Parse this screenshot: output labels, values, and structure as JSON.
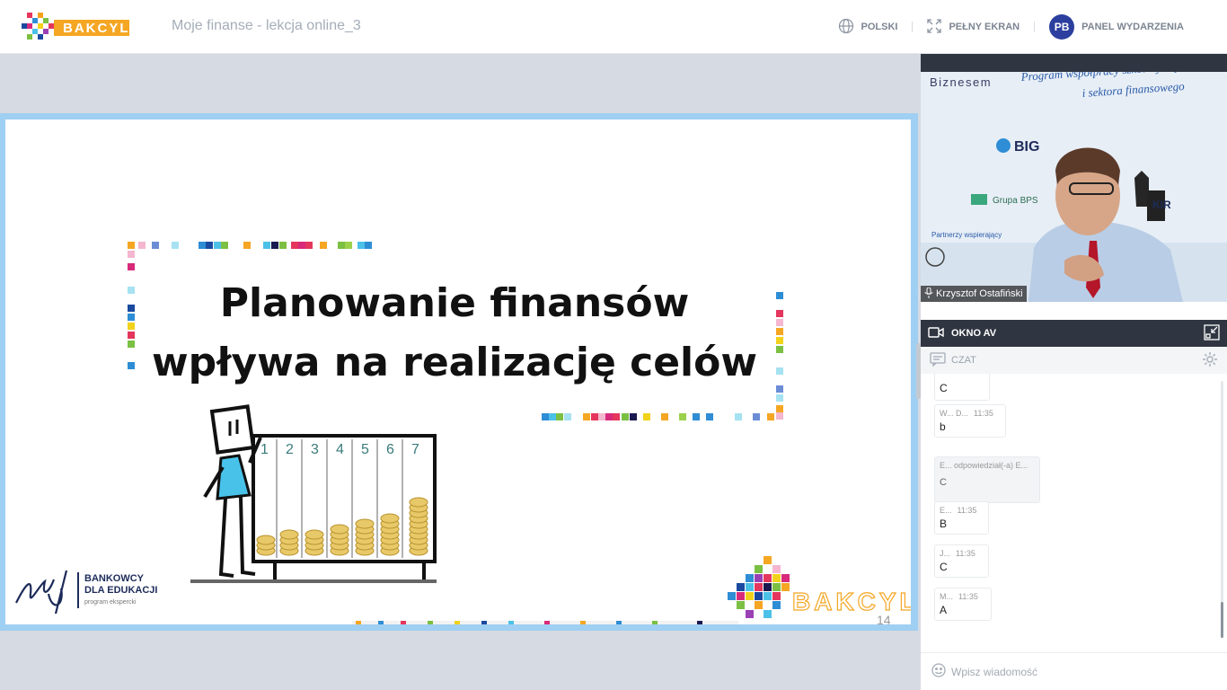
{
  "header": {
    "logo_text": "BAKCYL",
    "event_title": "Moje finanse - lekcja online_3",
    "language_label": "POLSKI",
    "fullscreen_label": "PEŁNY EKRAN",
    "avatar_initials": "PB",
    "panel_label": "PANEL WYDARZENIA"
  },
  "slide": {
    "title_line1": "Planowanie finansów",
    "title_line2": "wpływa na realizację celów",
    "page_number": "14",
    "sponsor_line1": "BANKOWCY",
    "sponsor_line2": "DLA EDUKACJI",
    "sponsor_line3": "program ekspercki",
    "footer_logo_text": "BAKCYL",
    "chart_labels": [
      "1",
      "2",
      "3",
      "4",
      "5",
      "6",
      "7"
    ]
  },
  "video": {
    "speaker_name": "Krzysztof Ostafiński",
    "banner_line1": "Program współpracy szkół wyższych",
    "banner_line2": "i sektora finansowego",
    "banner_left": "Biznesem",
    "big_logo": "BIG",
    "grupa_bps": "Grupa BPS",
    "partners": "Partnerzy wspierający"
  },
  "av": {
    "label": "OKNO AV"
  },
  "chat": {
    "label": "CZAT",
    "input_placeholder": "Wpisz wiadomość",
    "messages": [
      {
        "author": "",
        "time": "",
        "text": "C"
      },
      {
        "author": "W... D...",
        "time": "11:35",
        "text": "b"
      },
      {
        "author": "E... odpowiedział(-a) E...",
        "time": "",
        "text": "C"
      },
      {
        "author": "E...",
        "time": "11:35",
        "text": "B"
      },
      {
        "author": "J...",
        "time": "11:35",
        "text": "C"
      },
      {
        "author": "M...",
        "time": "11:35",
        "text": "A"
      }
    ]
  },
  "colors": {
    "accent": "#2c3f9e",
    "slide_border": "#9fcff2",
    "dark_bar": "#2f3641"
  }
}
